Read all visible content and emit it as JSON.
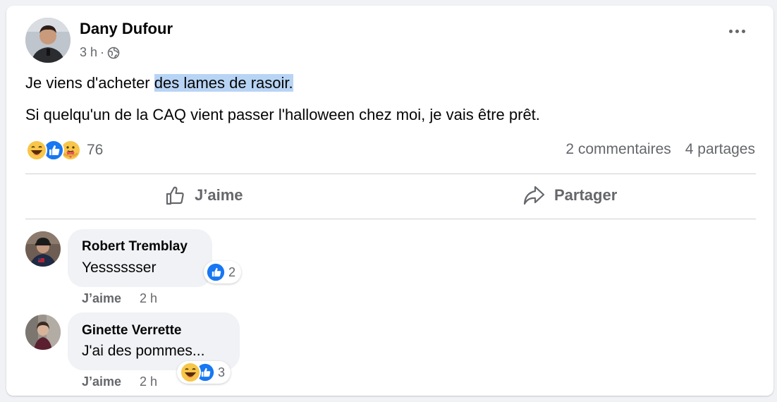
{
  "post": {
    "author": "Dany Dufour",
    "time": "3 h",
    "visibility_icon": "globe-icon",
    "line1_before": "Je viens d'acheter ",
    "line1_highlight": "des lames de rasoir.",
    "line2": "Si quelqu'un de la CAQ vient passer l'halloween chez moi, je vais être prêt.",
    "reactions": [
      "haha",
      "like",
      "care"
    ],
    "reaction_count": "76",
    "comments_count": "2 commentaires",
    "shares_count": "4 partages"
  },
  "actions": {
    "like_label": "J’aime",
    "share_label": "Partager"
  },
  "comments": [
    {
      "name": "Robert Tremblay",
      "text": "Yesssssser",
      "reactions": [
        "like"
      ],
      "reaction_count": "2",
      "like_label": "J’aime",
      "time": "2 h"
    },
    {
      "name": "Ginette Verrette",
      "text": "J'ai des pommes...",
      "reactions": [
        "haha",
        "like"
      ],
      "reaction_count": "3",
      "like_label": "J’aime",
      "time": "2 h"
    }
  ],
  "colors": {
    "like_blue": "#1877f2",
    "haha_yellow": "#f7c64a",
    "muted_text": "#65676b",
    "highlight": "#b8d4f5"
  }
}
